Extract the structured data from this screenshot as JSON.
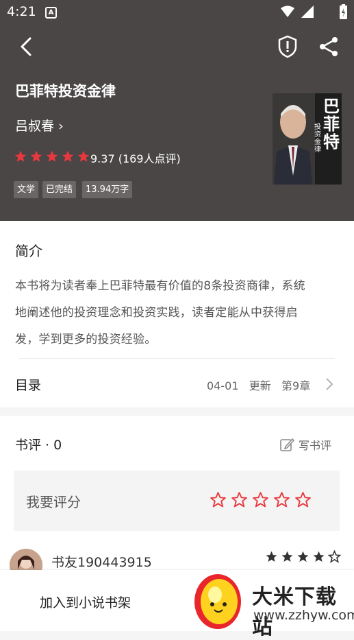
{
  "status": {
    "time": "4:21",
    "a_badge": "A"
  },
  "book": {
    "title": "巴菲特投资金律",
    "author": "吕叔春",
    "score_text": "9.37 (169人点评)",
    "rating_stars": 5,
    "tags": [
      "文学",
      "已完结",
      "13.94万字"
    ],
    "cover": {
      "title": "巴菲特",
      "subtitle": "投资金律"
    }
  },
  "intro": {
    "heading": "简介",
    "lines": [
      "本书将为读者奉上巴菲特最有价值的8条投资商律，系统",
      "地阐述他的投资理念和投资实践，读者定能从中获得启",
      "发，学到更多的投资经验。"
    ]
  },
  "toc": {
    "label": "目录",
    "date": "04-01",
    "update": "更新",
    "chapter": "第9章"
  },
  "reviews": {
    "heading": "书评 · 0",
    "write_label": "写书评",
    "rate_label": "我要评分",
    "user": {
      "name": "书友190443915",
      "stars": 4
    }
  },
  "bottom": {
    "add_shelf": "加入到小说书架"
  },
  "watermark": {
    "title": "大米下载站",
    "url": "www.zzhyw.com"
  },
  "colors": {
    "header_bg": "#4a4646",
    "star_red": "#e8383d"
  }
}
